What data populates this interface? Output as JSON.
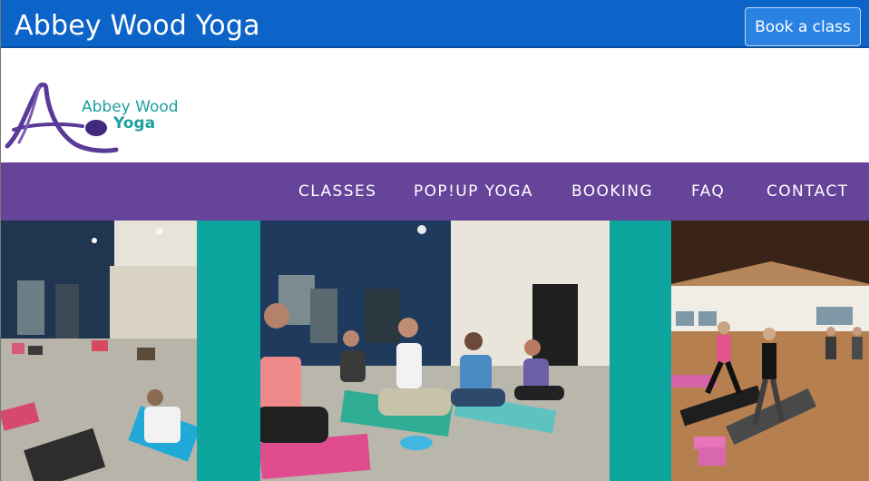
{
  "header": {
    "site_title": "Abbey Wood Yoga",
    "book_label": "Book a class"
  },
  "logo": {
    "line1": "Abbey Wood",
    "line2": "Yoga"
  },
  "nav": {
    "items": [
      "CLASSES",
      "POP!UP YOGA",
      "BOOKING",
      "FAQ",
      "CONTACT"
    ]
  },
  "colors": {
    "topbar": "#0c63c8",
    "nav": "#66449a",
    "teal": "#0fa59f",
    "logo_text": "#1c9f9f",
    "logo_mark": "#5a3a98"
  }
}
